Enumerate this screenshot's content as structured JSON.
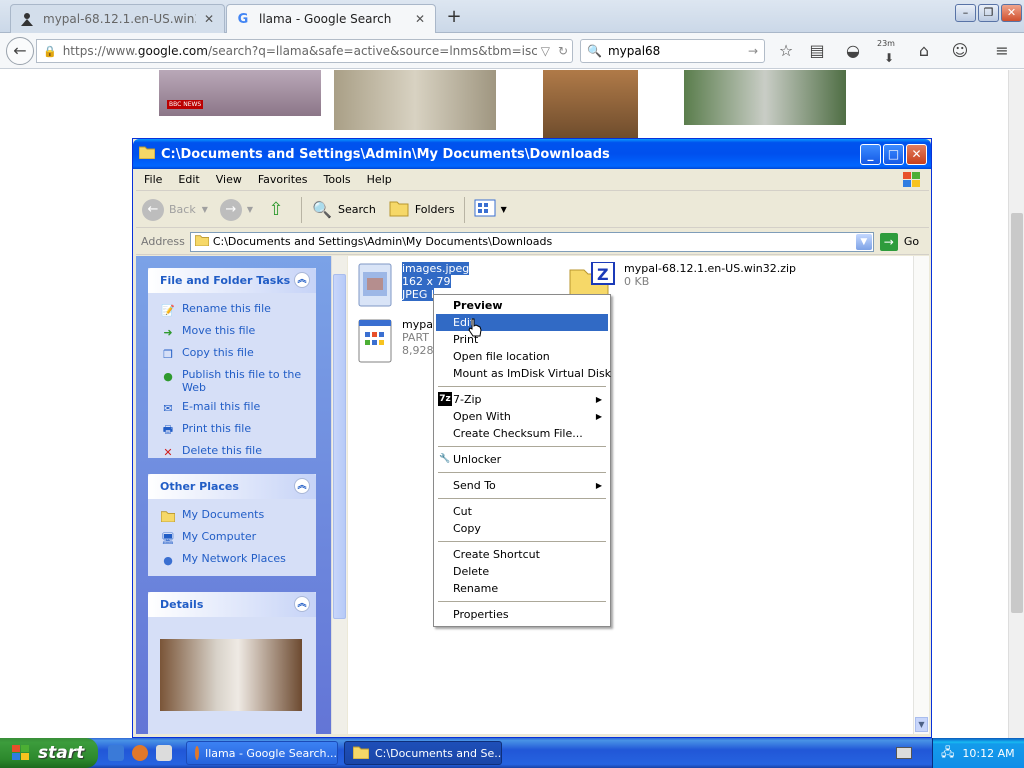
{
  "browser": {
    "tabs": [
      {
        "title": "mypal-68.12.1.en-US.win32...",
        "active": false
      },
      {
        "title": "llama - Google Search",
        "active": true
      }
    ],
    "url": {
      "prefix": "https://www.",
      "domain": "google.com",
      "rest": "/search?q=llama&safe=active&source=lnms&tbm=isch&sa=X&ved=0ahU"
    },
    "search_query": "mypal68",
    "badge": "23m"
  },
  "explorer": {
    "title": "C:\\Documents and Settings\\Admin\\My Documents\\Downloads",
    "menu": [
      "File",
      "Edit",
      "View",
      "Favorites",
      "Tools",
      "Help"
    ],
    "toolbar": {
      "back": "Back",
      "search": "Search",
      "folders": "Folders"
    },
    "address_label": "Address",
    "address_value": "C:\\Documents and Settings\\Admin\\My Documents\\Downloads",
    "go_label": "Go",
    "file_tasks": {
      "header": "File and Folder Tasks",
      "items": [
        "Rename this file",
        "Move this file",
        "Copy this file",
        "Publish this file to the Web",
        "E-mail this file",
        "Print this file",
        "Delete this file"
      ]
    },
    "other_places": {
      "header": "Other Places",
      "items": [
        "My Documents",
        "My Computer",
        "My Network Places"
      ]
    },
    "details": {
      "header": "Details"
    },
    "files": [
      {
        "name": "images.jpeg",
        "line2": "162 x 79",
        "line3": "JPEG I"
      },
      {
        "name": "mypal-68.12.1.en-US.win32.zip",
        "line2": "0 KB"
      },
      {
        "name": "mypal-",
        "line2": "PART",
        "line3": "8,928"
      }
    ]
  },
  "context_menu": {
    "preview": "Preview",
    "edit": "Edit",
    "print": "Print",
    "open_location": "Open file location",
    "mount": "Mount as ImDisk Virtual Disk",
    "zip": "7-Zip",
    "open_with": "Open With",
    "checksum": "Create Checksum File...",
    "unlocker": "Unlocker",
    "send_to": "Send To",
    "cut": "Cut",
    "copy": "Copy",
    "shortcut": "Create Shortcut",
    "delete": "Delete",
    "rename": "Rename",
    "properties": "Properties",
    "zip_icon_text": "7z"
  },
  "taskbar": {
    "start": "start",
    "buttons": [
      "llama - Google Search...",
      "C:\\Documents and Se..."
    ],
    "clock": "10:12 AM"
  },
  "thumb_badge": "BBC NEWS",
  "colors": {
    "xp_blue": "#0053ee",
    "selection": "#316ac5",
    "task_link": "#215dc6"
  }
}
